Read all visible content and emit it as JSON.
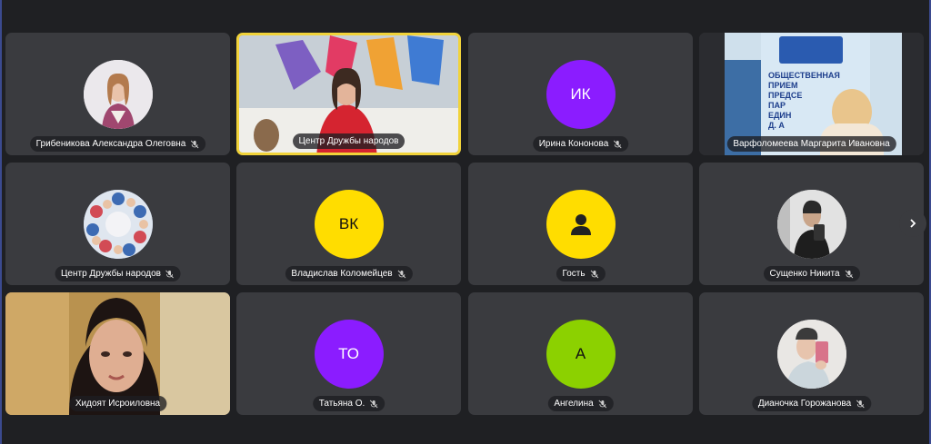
{
  "colors": {
    "background": "#1f2023",
    "tile": "#3a3b3f",
    "active_border": "#f1d33a",
    "avatar_yellow": "#ffdd00",
    "avatar_purple": "#8b1cff",
    "avatar_green": "#8cd100"
  },
  "tiles": [
    {
      "name": "Грибеникова Александра Олеговна",
      "kind": "photo-avatar",
      "muted": true
    },
    {
      "name": "Центр Дружбы народов",
      "kind": "video",
      "muted": false,
      "active": true
    },
    {
      "name": "Ирина Кононова",
      "kind": "initials",
      "initials": "ИК",
      "avatar_color": "#8b1cff",
      "muted": true
    },
    {
      "name": "Варфоломеева Маргарита Ивановна",
      "kind": "video",
      "muted": false,
      "poster_text": [
        "ОБЩЕСТВЕННАЯ",
        "ПРИЕМ",
        "ПРЕДСЕ",
        "ПАР",
        "ЕДИН",
        "Д. А"
      ]
    },
    {
      "name": "Центр Дружбы народов",
      "kind": "photo-avatar",
      "muted": true
    },
    {
      "name": "Владислав Коломейцев",
      "kind": "initials",
      "initials": "ВК",
      "avatar_color": "#ffdd00",
      "muted": true
    },
    {
      "name": "Гость",
      "kind": "guest-icon",
      "avatar_color": "#ffdd00",
      "muted": true
    },
    {
      "name": "Сущенко Никита",
      "kind": "photo-avatar",
      "muted": true
    },
    {
      "name": "Хидоят Исроиловна",
      "kind": "video",
      "muted": false
    },
    {
      "name": "Татьяна О.",
      "kind": "initials",
      "initials": "ТО",
      "avatar_color": "#8b1cff",
      "muted": true
    },
    {
      "name": "Ангелина",
      "kind": "initials",
      "initials": "А",
      "avatar_color": "#8cd100",
      "muted": true
    },
    {
      "name": "Дианочка Горожанова",
      "kind": "photo-avatar",
      "muted": true
    }
  ],
  "next_page_icon": "chevron-right-icon"
}
